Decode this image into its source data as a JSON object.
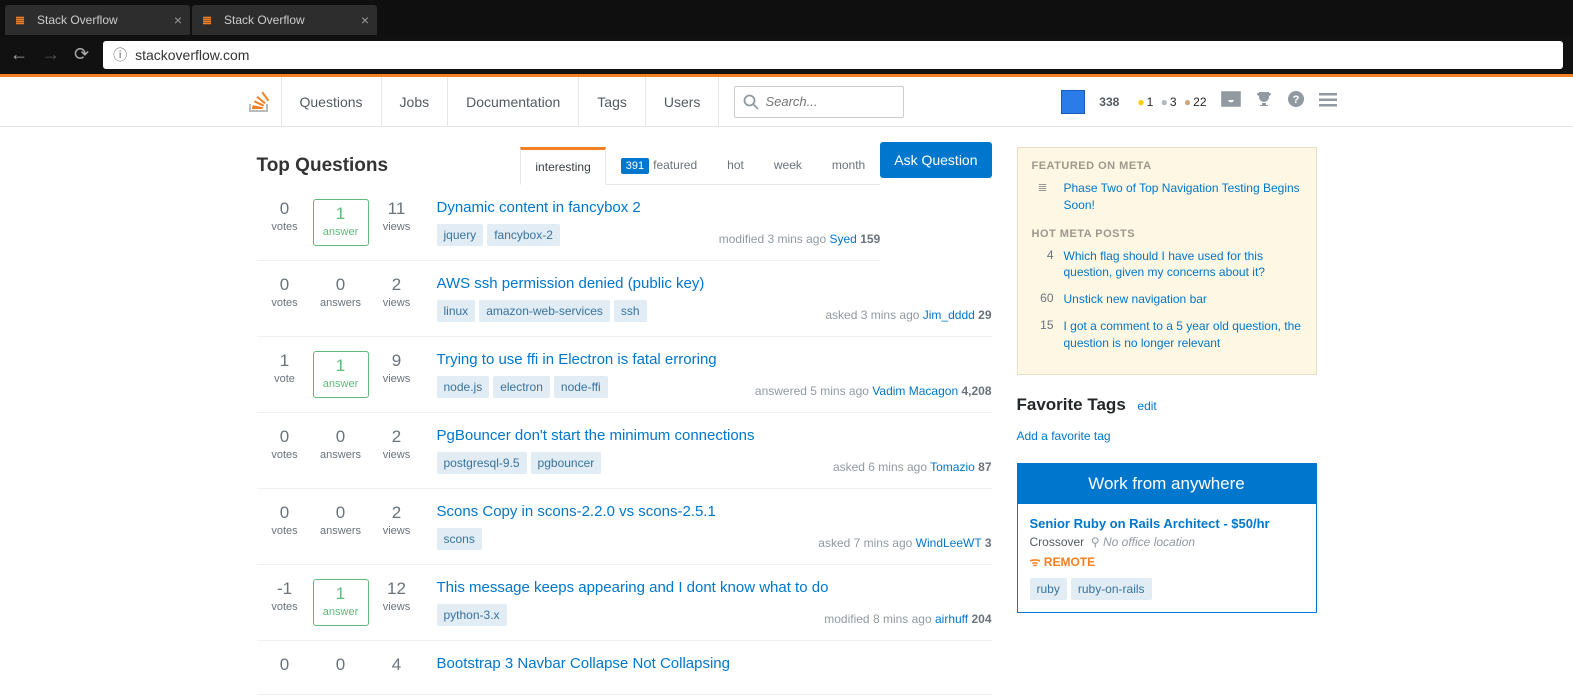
{
  "browser": {
    "tabs": [
      {
        "title": "Stack Overflow"
      },
      {
        "title": "Stack Overflow"
      }
    ],
    "url": "stackoverflow.com"
  },
  "nav": {
    "items": [
      "Questions",
      "Jobs",
      "Documentation",
      "Tags",
      "Users"
    ],
    "search_placeholder": "Search..."
  },
  "user": {
    "rep": "338",
    "gold": "1",
    "silver": "3",
    "bronze": "22"
  },
  "page": {
    "title": "Top Questions",
    "ask": "Ask Question"
  },
  "subtabs": [
    {
      "label": "interesting",
      "active": true
    },
    {
      "label": "featured",
      "count": "391"
    },
    {
      "label": "hot"
    },
    {
      "label": "week"
    },
    {
      "label": "month"
    }
  ],
  "questions": [
    {
      "votes": "0",
      "votes_l": "votes",
      "answers": "1",
      "answers_l": "answer",
      "answered": true,
      "views": "11",
      "views_l": "views",
      "title": "Dynamic content in fancybox 2",
      "tags": [
        "jquery",
        "fancybox-2"
      ],
      "action": "modified 3 mins ago",
      "author": "Syed",
      "rep": "159"
    },
    {
      "votes": "0",
      "votes_l": "votes",
      "answers": "0",
      "answers_l": "answers",
      "answered": false,
      "views": "2",
      "views_l": "views",
      "title": "AWS ssh permission denied (public key)",
      "tags": [
        "linux",
        "amazon-web-services",
        "ssh"
      ],
      "action": "asked 3 mins ago",
      "author": "Jim_dddd",
      "rep": "29"
    },
    {
      "votes": "1",
      "votes_l": "vote",
      "answers": "1",
      "answers_l": "answer",
      "answered": true,
      "views": "9",
      "views_l": "views",
      "title": "Trying to use ffi in Electron is fatal erroring",
      "tags": [
        "node.js",
        "electron",
        "node-ffi"
      ],
      "action": "answered 5 mins ago",
      "author": "Vadim Macagon",
      "rep": "4,208"
    },
    {
      "votes": "0",
      "votes_l": "votes",
      "answers": "0",
      "answers_l": "answers",
      "answered": false,
      "views": "2",
      "views_l": "views",
      "title": "PgBouncer don't start the minimum connections",
      "tags": [
        "postgresql-9.5",
        "pgbouncer"
      ],
      "action": "asked 6 mins ago",
      "author": "Tomazio",
      "rep": "87"
    },
    {
      "votes": "0",
      "votes_l": "votes",
      "answers": "0",
      "answers_l": "answers",
      "answered": false,
      "views": "2",
      "views_l": "views",
      "title": "Scons Copy in scons-2.2.0 vs scons-2.5.1",
      "tags": [
        "scons"
      ],
      "action": "asked 7 mins ago",
      "author": "WindLeeWT",
      "rep": "3"
    },
    {
      "votes": "-1",
      "votes_l": "votes",
      "answers": "1",
      "answers_l": "answer",
      "answered": true,
      "views": "12",
      "views_l": "views",
      "title": "This message keeps appearing and I dont know what to do",
      "tags": [
        "python-3.x"
      ],
      "action": "modified 8 mins ago",
      "author": "airhuff",
      "rep": "204"
    },
    {
      "votes": "0",
      "votes_l": "",
      "answers": "0",
      "answers_l": "",
      "answered": false,
      "views": "4",
      "views_l": "",
      "title": "Bootstrap 3 Navbar Collapse Not Collapsing",
      "tags": [],
      "action": "",
      "author": "",
      "rep": ""
    }
  ],
  "bulletin": {
    "featured_h": "FEATURED ON META",
    "featured": [
      {
        "text": "Phase Two of Top Navigation Testing Begins Soon!"
      }
    ],
    "hot_h": "HOT META POSTS",
    "hot": [
      {
        "count": "4",
        "text": "Which flag should I have used for this question, given my concerns about it?"
      },
      {
        "count": "60",
        "text": "Unstick new navigation bar"
      },
      {
        "count": "15",
        "text": "I got a comment to a 5 year old question, the question is no longer relevant"
      }
    ]
  },
  "fav": {
    "title": "Favorite Tags",
    "edit": "edit",
    "add": "Add a favorite tag"
  },
  "job": {
    "head": "Work from anywhere",
    "title": "Senior Ruby on Rails Architect - $50/hr",
    "company": "Crossover",
    "location": "No office location",
    "remote": "REMOTE",
    "tags": [
      "ruby",
      "ruby-on-rails"
    ]
  }
}
